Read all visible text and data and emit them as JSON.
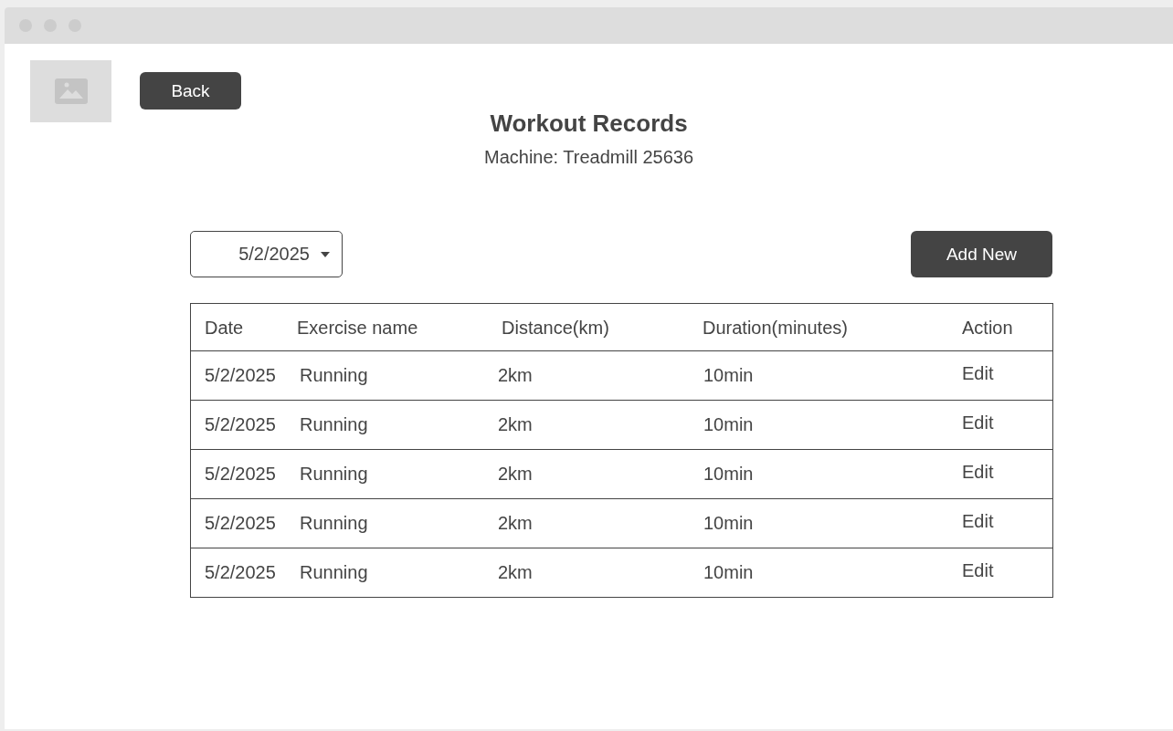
{
  "header": {
    "back_button": "Back",
    "title": "Workout Records",
    "subtitle": "Machine: Treadmill 25636"
  },
  "toolbar": {
    "date_select": "5/2/2025",
    "add_button": "Add New"
  },
  "table": {
    "columns": [
      "Date",
      "Exercise name",
      "Distance(km)",
      "Duration(minutes)",
      "Action"
    ],
    "rows": [
      {
        "date": "5/2/2025",
        "exercise": "Running",
        "distance": "2km",
        "duration": "10min",
        "action": "Edit"
      },
      {
        "date": "5/2/2025",
        "exercise": "Running",
        "distance": "2km",
        "duration": "10min",
        "action": "Edit"
      },
      {
        "date": "5/2/2025",
        "exercise": "Running",
        "distance": "2km",
        "duration": "10min",
        "action": "Edit"
      },
      {
        "date": "5/2/2025",
        "exercise": "Running",
        "distance": "2km",
        "duration": "10min",
        "action": "Edit"
      },
      {
        "date": "5/2/2025",
        "exercise": "Running",
        "distance": "2km",
        "duration": "10min",
        "action": "Edit"
      }
    ]
  }
}
